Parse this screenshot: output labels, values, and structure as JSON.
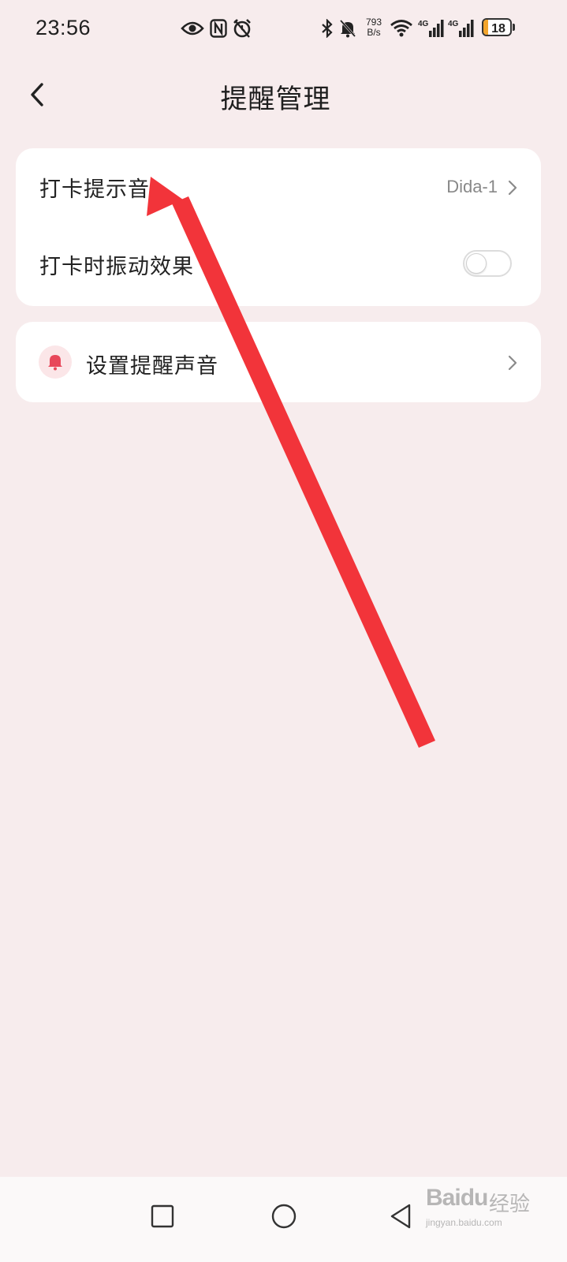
{
  "status_bar": {
    "time": "23:56",
    "net_speed_value": "793",
    "net_speed_unit": "B/s",
    "battery_level": "18",
    "battery_fraction": 0.18,
    "icons": [
      "eye-icon",
      "nfc-icon",
      "alarm-icon",
      "bluetooth-icon",
      "bell-off-icon",
      "wifi-icon",
      "signal-4g-icon",
      "signal-4g-icon",
      "battery-icon"
    ]
  },
  "header": {
    "title": "提醒管理",
    "back_icon": "chevron-left-icon"
  },
  "settings_card": {
    "rows": [
      {
        "label": "打卡提示音",
        "value": "Dida-1",
        "icon": "chevron-right-icon"
      },
      {
        "label": "打卡时振动效果",
        "toggle_on": false
      }
    ]
  },
  "reminder_card": {
    "label": "设置提醒声音",
    "icon": "bell-icon",
    "chevron": "chevron-right-icon"
  },
  "annotation": {
    "type": "red-arrow",
    "color": "#f2343a"
  },
  "nav_bar": {
    "buttons": [
      "recents-square-icon",
      "home-circle-icon",
      "back-triangle-icon"
    ]
  },
  "watermark": {
    "brand": "Bai",
    "brand_tail": "du",
    "suffix": "经验",
    "url": "jingyan.baidu.com"
  },
  "colors": {
    "background": "#f7eced",
    "card": "#ffffff",
    "accent": "#e8475a",
    "bell_bg": "#fbe6e8"
  }
}
